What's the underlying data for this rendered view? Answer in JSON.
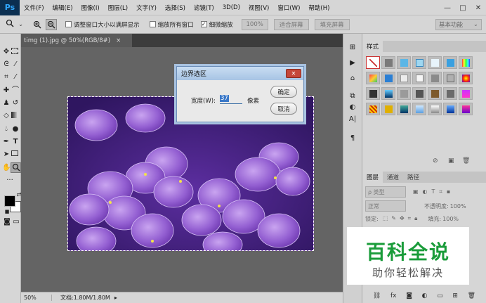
{
  "menubar": {
    "logo": "Ps",
    "items": [
      "文件(F)",
      "编辑(E)",
      "图像(I)",
      "图层(L)",
      "文字(Y)",
      "选择(S)",
      "滤镜(T)",
      "3D(D)",
      "视图(V)",
      "窗口(W)",
      "帮助(H)"
    ],
    "window_buttons": [
      "—",
      "□",
      "✕"
    ]
  },
  "optionsbar": {
    "check1": "调整窗口大小以满屏显示",
    "check2": "缩放所有窗口",
    "check3": "细微缩放",
    "zoom_value": "100%",
    "fit_screen": "适合屏幕",
    "fill_screen": "填充屏幕",
    "workspace": "基本功能"
  },
  "document": {
    "tab_title": "timg (1).jpg @ 50%(RGB/8#)",
    "tab_close": "×"
  },
  "statusbar": {
    "zoom": "50%",
    "doc_info": "文档:1.80M/1.80M"
  },
  "dialog": {
    "title": "边界选区",
    "close": "✕",
    "width_label": "宽度(W):",
    "width_value": "37",
    "unit": "像素",
    "ok": "确定",
    "cancel": "取消"
  },
  "styles_panel": {
    "tab": "样式"
  },
  "layers_panel": {
    "tabs": [
      "图层",
      "通道",
      "路径"
    ],
    "filter_kind": "ρ 类型",
    "blend_mode": "正常",
    "opacity_label": "不透明度:",
    "opacity_value": "100%",
    "lock_label": "锁定:",
    "fill_label": "填充:",
    "fill_value": "100%"
  },
  "watermark": {
    "title": "百科全说",
    "subtitle": "助你轻松解决"
  },
  "colors": {
    "accent": "#31a8ff",
    "watermark_green": "#1a9c3a",
    "petal": "#8a55c9"
  }
}
